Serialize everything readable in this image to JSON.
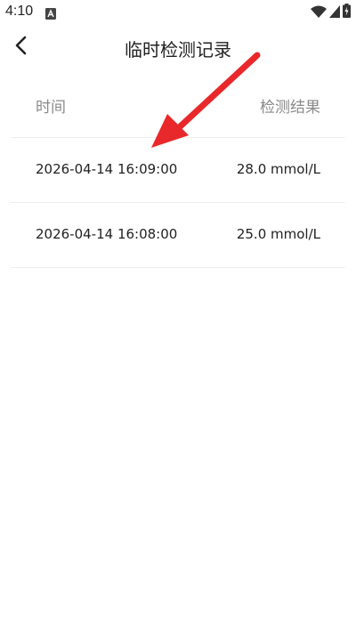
{
  "status_bar": {
    "time": "4:10",
    "icons": [
      "notification-a-icon",
      "wifi-icon",
      "signal-icon",
      "battery-charging-icon"
    ]
  },
  "header": {
    "title": "临时检测记录",
    "back_icon": "chevron-left-icon"
  },
  "table": {
    "columns": {
      "time_label": "时间",
      "result_label": "检测结果"
    },
    "rows": [
      {
        "time": "2026-04-14 16:09:00",
        "result": "28.0 mmol/L"
      },
      {
        "time": "2026-04-14 16:08:00",
        "result": "25.0 mmol/L"
      }
    ]
  },
  "colors": {
    "annotation_arrow": "#e8282a",
    "label_gray": "#8a8a8a",
    "divider": "#eeeeee"
  }
}
